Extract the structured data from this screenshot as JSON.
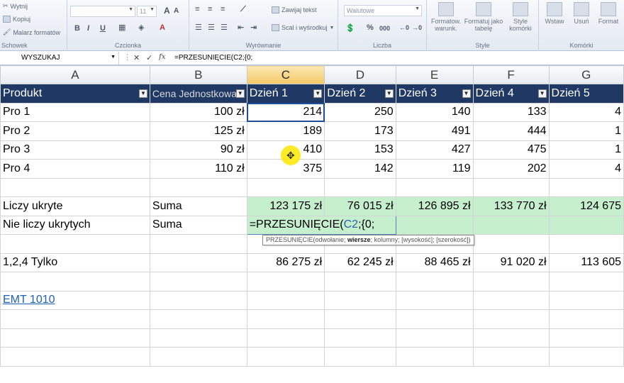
{
  "ribbon": {
    "clipboard": {
      "cut": "Wytnij",
      "copy": "Kopiuj",
      "painter": "Malarz formatów",
      "group": "Schowek"
    },
    "font": {
      "size": "11",
      "grow": "A",
      "shrink": "A",
      "bold": "B",
      "italic": "I",
      "underline": "U",
      "group": "Czcionka"
    },
    "alignment": {
      "wrap": "Zawijaj tekst",
      "merge": "Scal i wyśrodkuj",
      "group": "Wyrównanie"
    },
    "number": {
      "format": "Walutowe",
      "percent": "%",
      "thousands": "000",
      "group": "Liczba"
    },
    "styles": {
      "conditional": "Formatow. warunk.",
      "table": "Formatuj jako tabelę",
      "cell": "Style komórki",
      "group": "Style"
    },
    "cells": {
      "insert": "Wstaw",
      "delete": "Usuń",
      "format": "Format",
      "group": "Komórki"
    }
  },
  "formula_bar": {
    "name_box": "WYSZUKAJ",
    "cancel_icon": "✕",
    "enter_icon": "✓",
    "fx": "fx",
    "formula": "=PRZESUNIĘCIE(C2;{0;"
  },
  "columns": [
    "A",
    "B",
    "C",
    "D",
    "E",
    "F",
    "G"
  ],
  "header_row": [
    "Produkt",
    "Cena Jednostkowa",
    "Dzień 1",
    "Dzień 2",
    "Dzień 3",
    "Dzień 4",
    "Dzień 5"
  ],
  "products": [
    {
      "name": "Pro 1",
      "price": "100 zł",
      "d1": "214",
      "d2": "250",
      "d3": "140",
      "d4": "133",
      "d5": "4"
    },
    {
      "name": "Pro 2",
      "price": "125 zł",
      "d1": "189",
      "d2": "173",
      "d3": "491",
      "d4": "444",
      "d5": "1"
    },
    {
      "name": "Pro 3",
      "price": "90 zł",
      "d1": "410",
      "d2": "153",
      "d3": "427",
      "d4": "475",
      "d5": "1"
    },
    {
      "name": "Pro 4",
      "price": "110 zł",
      "d1": "375",
      "d2": "142",
      "d3": "119",
      "d4": "202",
      "d5": "4"
    }
  ],
  "hidden": {
    "label": "Liczy ukryte",
    "func": "Suma",
    "values": [
      "123 175 zł",
      "76 015 zł",
      "126 895 zł",
      "133 770 zł",
      "124 675"
    ]
  },
  "not_hidden": {
    "label": "Nie liczy ukrytych",
    "func": "Suma",
    "formula_start": "=PRZESUNIĘCIE(",
    "formula_ref": "C2",
    "formula_end": ";{0;"
  },
  "tooltip": {
    "pre": "PRZESUNIĘCIE(odwołanie; ",
    "bold": "wiersze",
    "post": "; kolumny; [wysokość]; [szerokość])"
  },
  "only": {
    "label": "1,2,4 Tylko",
    "values": [
      "86 275 zł",
      "62 245 zł",
      "88 465 zł",
      "91 020 zł",
      "113 605"
    ]
  },
  "link": "EMT 1010"
}
